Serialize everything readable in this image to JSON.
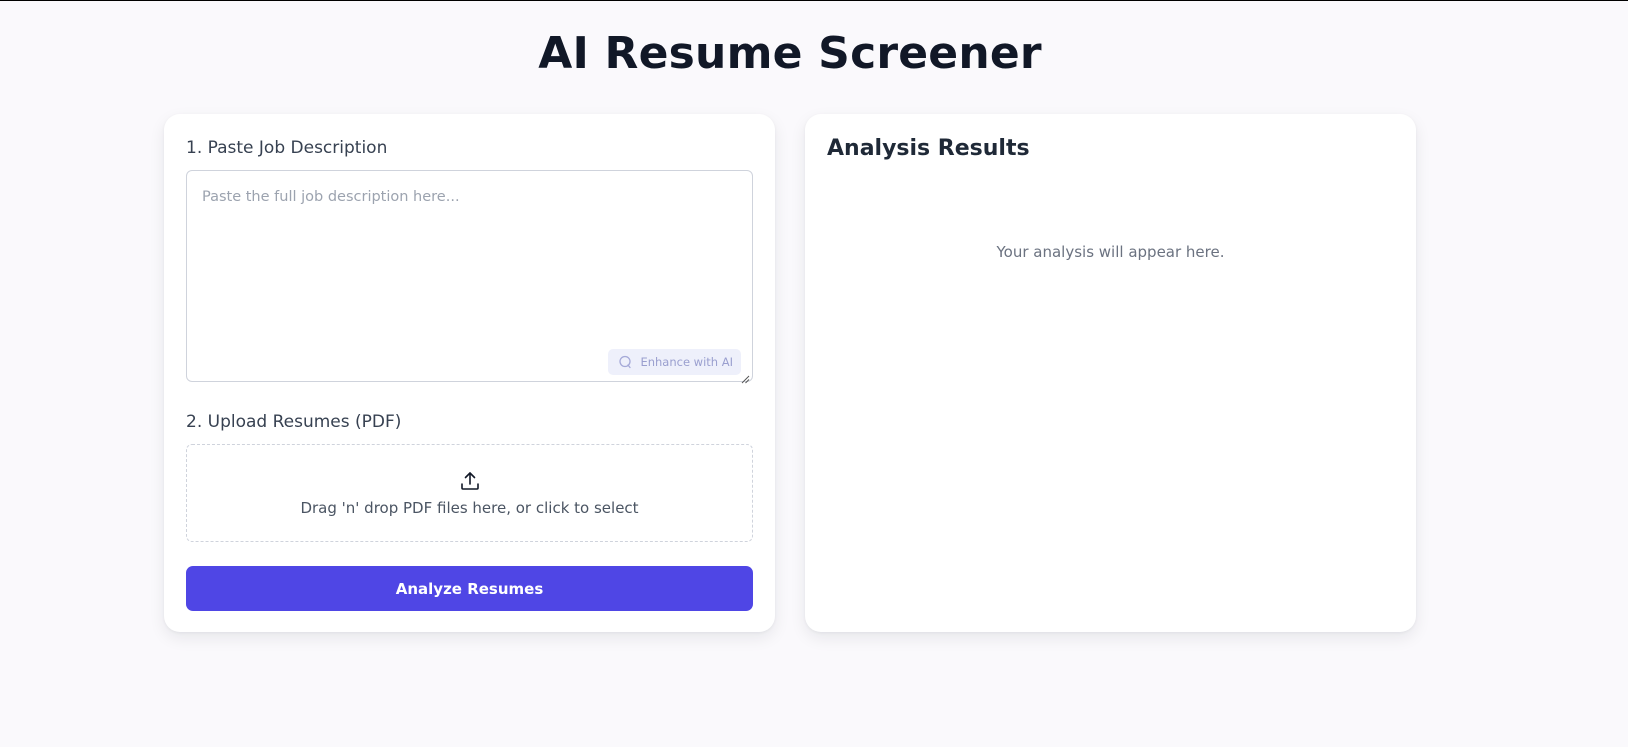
{
  "page": {
    "title": "AI Resume Screener"
  },
  "job_description": {
    "label": "1. Paste Job Description",
    "placeholder": "Paste the full job description here...",
    "value": "",
    "enhance_label": "Enhance with AI"
  },
  "upload": {
    "label": "2. Upload Resumes (PDF)",
    "dropzone_text": "Drag 'n' drop PDF files here, or click to select"
  },
  "actions": {
    "analyze_label": "Analyze Resumes"
  },
  "results": {
    "title": "Analysis Results",
    "placeholder": "Your analysis will appear here."
  },
  "colors": {
    "accent": "#4f46e5",
    "background": "#faf9fc",
    "card": "#ffffff",
    "enhance_bg": "#eef0fb"
  },
  "icons": {
    "upload": "upload-icon",
    "enhance": "sparkle-icon"
  }
}
